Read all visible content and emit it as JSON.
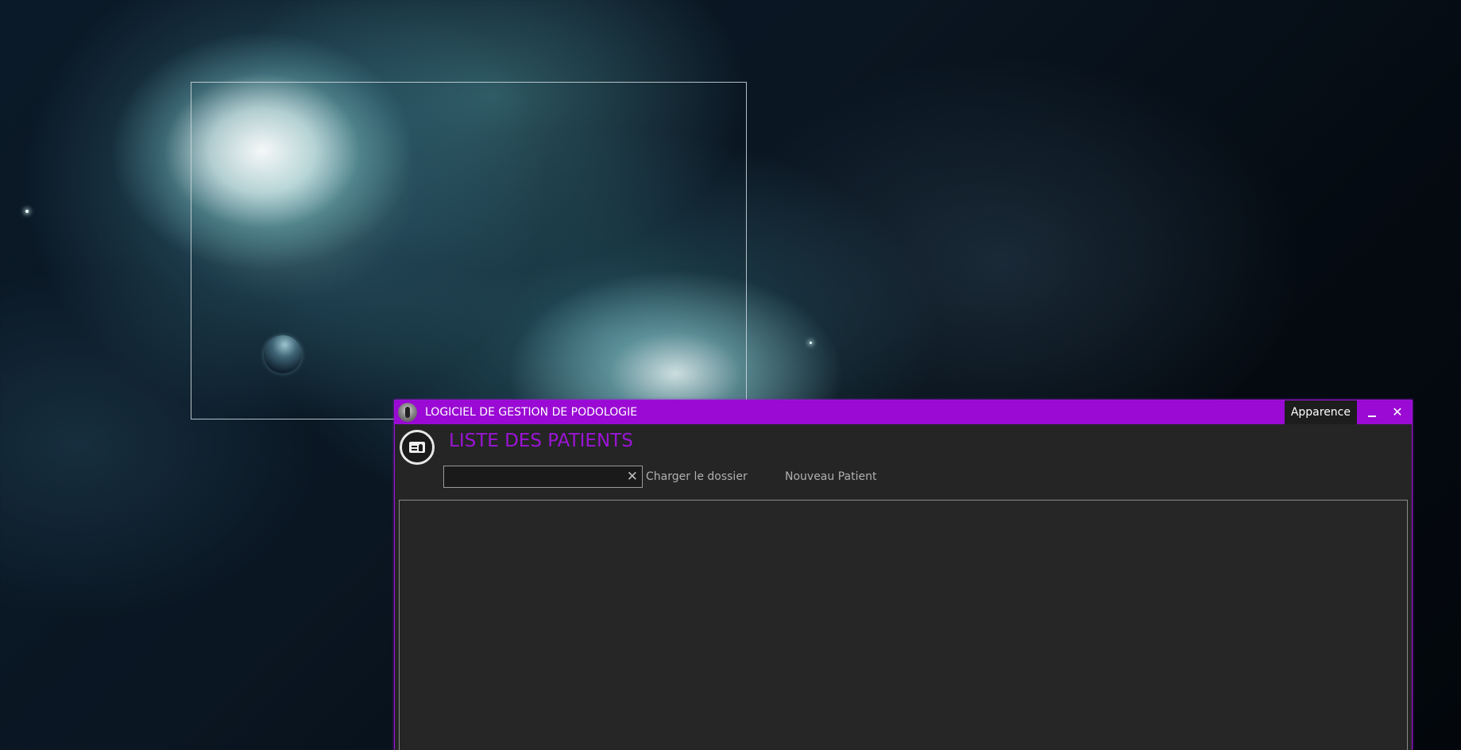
{
  "window": {
    "title": "LOGICIEL DE GESTION DE PODOLOGIE",
    "appearance_label": "Apparence",
    "minimize_icon": "minimize-icon",
    "close_glyph": "✕",
    "accent_color": "#9b14d6"
  },
  "header": {
    "icon": "patient-card-icon",
    "title": "LISTE DES PATIENTS"
  },
  "search": {
    "value": "",
    "placeholder": "",
    "clear_glyph": "✕"
  },
  "toolbar": {
    "load_folder_label": "Charger le dossier",
    "new_patient_label": "Nouveau Patient"
  },
  "patient_list": {
    "rows": []
  }
}
